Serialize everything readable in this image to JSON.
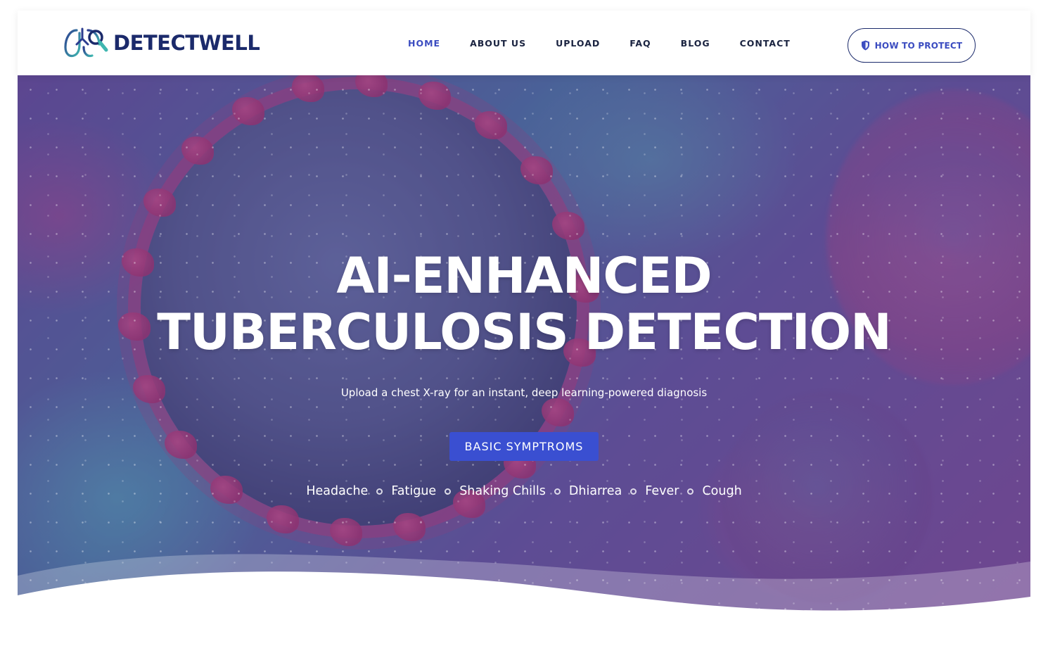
{
  "header": {
    "logo_text": "DETECTWELL",
    "nav": [
      {
        "label": "HOME",
        "active": true
      },
      {
        "label": "ABOUT US",
        "active": false
      },
      {
        "label": "UPLOAD",
        "active": false
      },
      {
        "label": "FAQ",
        "active": false
      },
      {
        "label": "BLOG",
        "active": false
      },
      {
        "label": "CONTACT",
        "active": false
      }
    ],
    "cta_label": "HOW TO PROTECT"
  },
  "hero": {
    "title_line1": "AI-ENHANCED",
    "title_line2": "TUBERCULOSIS DETECTION",
    "subtitle": "Upload a chest X-ray for an instant, deep learning-powered diagnosis",
    "button_label": "BASIC SYMPTROMS",
    "symptoms": [
      "Headache",
      "Fatigue",
      "Shaking Chills",
      "Dhiarrea",
      "Fever",
      "Cough"
    ]
  },
  "colors": {
    "brand_dark": "#1b2a6b",
    "accent": "#3b4cc0",
    "button_bg": "#3a4fd1",
    "logo_teal": "#3fb6b0"
  },
  "icons": {
    "logo": "lungs-magnifier-icon",
    "cta": "shield-icon"
  }
}
